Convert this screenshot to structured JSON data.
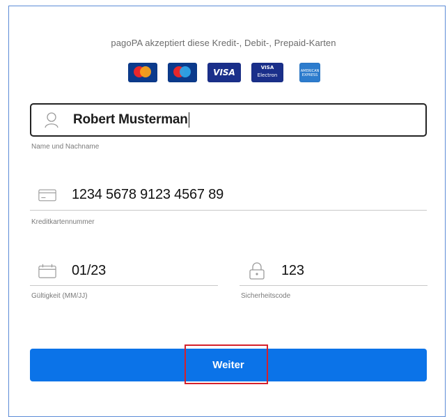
{
  "header": {
    "accept_text": "pagoPA akzeptiert diese Kredit-, Debit-, Prepaid-Karten"
  },
  "cards": [
    {
      "name": "mastercard",
      "text": ""
    },
    {
      "name": "maestro",
      "text": ""
    },
    {
      "name": "visa",
      "text": "VISA"
    },
    {
      "name": "visa-electron",
      "text_top": "VISA",
      "text_bottom": "Electron"
    },
    {
      "name": "american-express",
      "text": "AMERICAN EXPRESS"
    }
  ],
  "form": {
    "name": {
      "value": "Robert Musterman",
      "label": "Name und Nachname",
      "icon": "user-icon"
    },
    "card_number": {
      "value": "1234 5678 9123 4567 89",
      "label": "Kreditkartennummer",
      "icon": "credit-card-icon"
    },
    "expiry": {
      "value": "01/23",
      "label": "Gültigkeit (MM/JJ)",
      "icon": "calendar-icon"
    },
    "cvv": {
      "value": "123",
      "label": "Sicherheitscode",
      "icon": "lock-icon"
    }
  },
  "actions": {
    "submit_label": "Weiter"
  },
  "colors": {
    "primary": "#0b73e8",
    "highlight": "#d6202b",
    "frame": "#5b8bd6"
  }
}
